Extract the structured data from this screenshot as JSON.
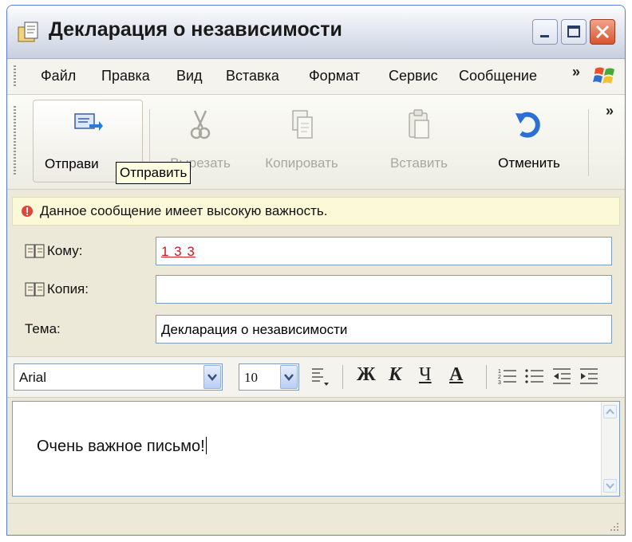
{
  "window": {
    "title": "Декларация о независимости",
    "app_icon": "envelope-document-icon",
    "controls": {
      "minimize": "minimize-icon",
      "maximize": "maximize-icon",
      "close": "close-icon"
    }
  },
  "menu": {
    "items": [
      "Файл",
      "Правка",
      "Вид",
      "Вставка",
      "Формат",
      "Сервис",
      "Сообщение"
    ],
    "overflow": "»"
  },
  "toolbar": {
    "buttons": [
      {
        "label": "Отправить",
        "icon": "send-icon",
        "enabled": true
      },
      {
        "label": "Вырезать",
        "icon": "scissors-icon",
        "enabled": false
      },
      {
        "label": "Копировать",
        "icon": "copy-icon",
        "enabled": false
      },
      {
        "label": "Вставить",
        "icon": "paste-icon",
        "enabled": false
      },
      {
        "label": "Отменить",
        "icon": "undo-icon",
        "enabled": true
      }
    ],
    "overflow": "»",
    "tooltip": "Отправить",
    "send_visible_text": "Отправи"
  },
  "info_bar": {
    "text": "Данное сообщение имеет высокую важность.",
    "icon": "high-importance-icon"
  },
  "header_fields": {
    "to_label": "Кому:",
    "to_value": "1 3 3",
    "cc_label": "Копия:",
    "cc_value": "",
    "subject_label": "Тема:",
    "subject_value": "Декларация о независимости"
  },
  "format_bar": {
    "font": "Arial",
    "size": "10",
    "bold": "Ж",
    "italic": "К",
    "underline": "Ч",
    "font_color": "А"
  },
  "body": {
    "text": "Очень важное письмо!"
  },
  "colors": {
    "title_bar": "#d8dde9",
    "close_button": "#d8532f",
    "info_bar": "#fbf9d8",
    "recipient_link": "#d0181c"
  }
}
